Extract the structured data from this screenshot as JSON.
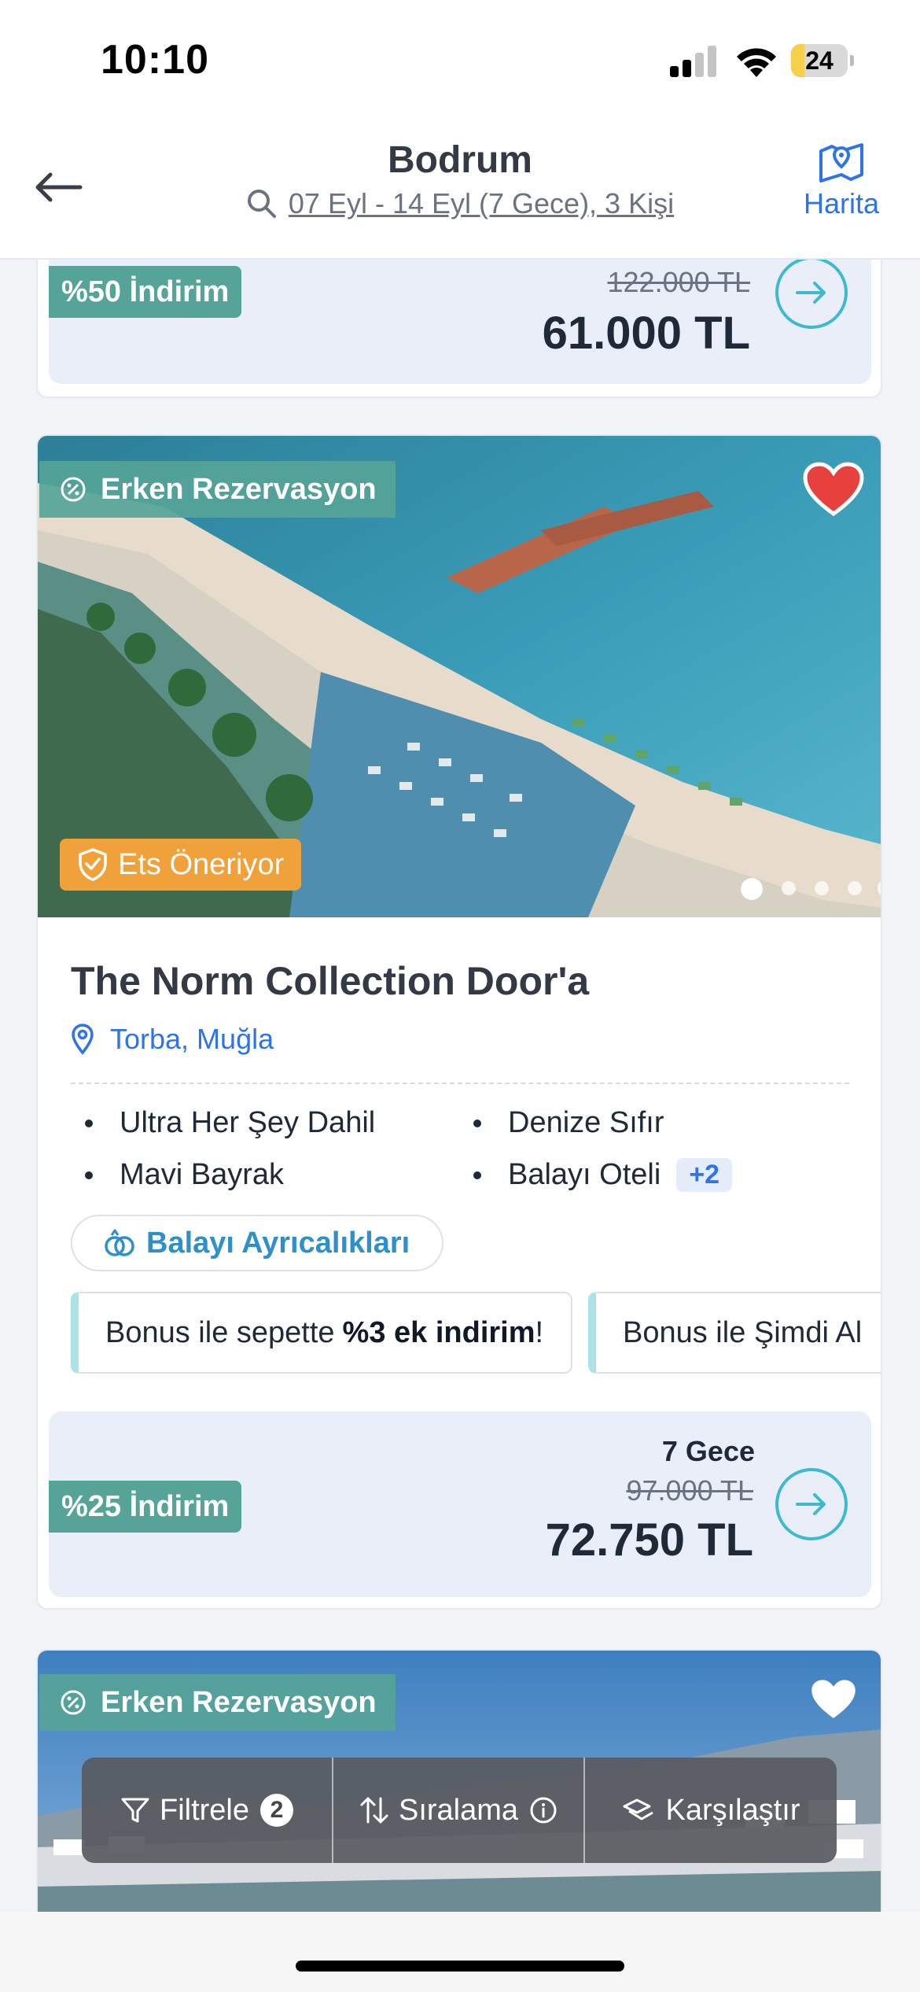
{
  "status_bar": {
    "time": "10:10",
    "battery": "24",
    "battery_level": 0.24
  },
  "header": {
    "title": "Bodrum",
    "search_summary": "07 Eyl - 14 Eyl (7 Gece), 3 Kişi",
    "map_label": "Harita",
    "back_icon": "arrow-left-icon",
    "search_icon": "search-icon",
    "map_icon": "map-pin-icon"
  },
  "prev_card": {
    "discount": "%50 İndirim",
    "old_price": "122.000 TL",
    "new_price": "61.000 TL"
  },
  "hotel_card": {
    "badge_early": "Erken Rezervasyon",
    "badge_ets": "Ets Öneriyor",
    "favorite": true,
    "photo_index": 1,
    "photo_count": 5,
    "name": "The Norm Collection Door'a",
    "location": "Torba, Muğla",
    "features": [
      "Ultra Her Şey Dahil",
      "Denize Sıfır",
      "Mavi Bayrak",
      "Balayı Oteli"
    ],
    "more_features": "+2",
    "perk_button": "Balayı Ayrıcalıkları",
    "promos": [
      {
        "prefix": "Bonus ile sepette",
        "bold": "%3 ek indirim",
        "suffix": "!"
      },
      {
        "prefix": "Bonus ile Şimdi Al",
        "bold": "",
        "suffix": ""
      }
    ],
    "nights": "7 Gece",
    "discount": "%25 İndirim",
    "old_price": "97.000 TL",
    "new_price": "72.750 TL"
  },
  "next_card": {
    "badge_early": "Erken Rezervasyon",
    "favorite": false
  },
  "action_bar": {
    "filter_label": "Filtrele",
    "filter_count": "2",
    "sort_label": "Sıralama",
    "compare_label": "Karşılaştır"
  },
  "colors": {
    "accent_blue": "#2f74e6",
    "teal": "#56a498",
    "orange": "#f0a13a",
    "arrow_ring": "#3fb9cf",
    "heart_red": "#e8403c"
  }
}
